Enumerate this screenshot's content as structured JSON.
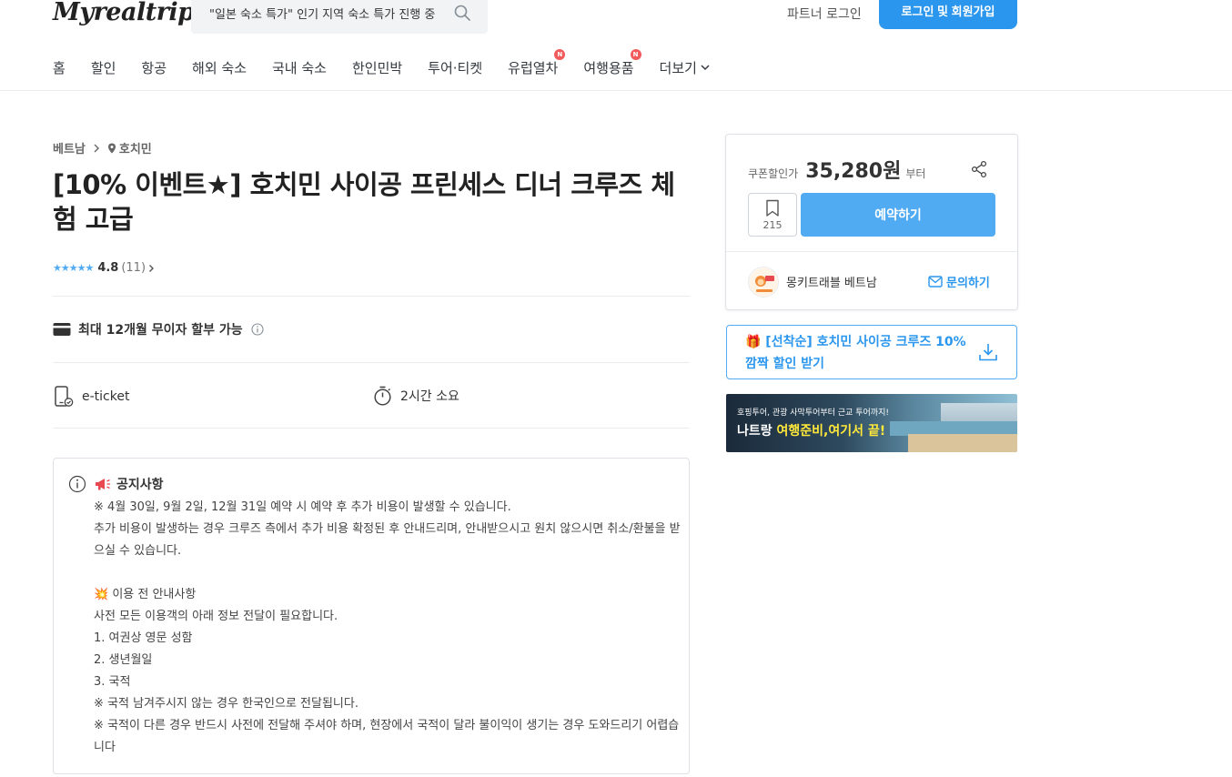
{
  "header": {
    "logo": "Myrealtrip",
    "search_text": "\"일본 숙소 특가\" 인기 지역 숙소 특가 진행 중",
    "partner_login": "파트너 로그인",
    "login_signup": "로그인 및 회원가입"
  },
  "nav": {
    "items": [
      {
        "label": "홈",
        "badge": ""
      },
      {
        "label": "할인",
        "badge": ""
      },
      {
        "label": "항공",
        "badge": ""
      },
      {
        "label": "해외 숙소",
        "badge": ""
      },
      {
        "label": "국내 숙소",
        "badge": ""
      },
      {
        "label": "한인민박",
        "badge": ""
      },
      {
        "label": "투어·티켓",
        "badge": ""
      },
      {
        "label": "유럽열차",
        "badge": "N"
      },
      {
        "label": "여행용품",
        "badge": "N"
      }
    ],
    "more": "더보기"
  },
  "breadcrumb": {
    "country": "베트남",
    "city": "호치민"
  },
  "product": {
    "title": "[10% 이벤트★] 호치민 사이공 프린세스 디너 크루즈 체험 고급",
    "stars": "★★★★★",
    "rating_score": "4.8",
    "rating_count": "(11)",
    "installment": "최대 12개월 무이자 할부 가능",
    "ticket_type": "e-ticket",
    "duration": "2시간 소요"
  },
  "notice": {
    "title": "공지사항",
    "lines": [
      "※ 4월 30일, 9월 2일, 12월 31일 예약 시 예약 후 추가 비용이 발생할 수 있습니다.",
      "추가 비용이 발생하는 경우 크루즈 측에서 추가 비용 확정된 후 안내드리며, 안내받으시고 원치 않으시면 취소/환불을 받으실 수 있습니다.",
      "",
      "💥 이용 전 안내사항",
      "사전 모든 이용객의 아래 정보 전달이 필요합니다.",
      "1. 여권상 영문 성함",
      "2. 생년월일",
      "3. 국적",
      "※ 국적 남겨주시지 않는 경우 한국인으로 전달됩니다.",
      "※ 국적이 다른 경우 반드시 사전에 전달해 주셔야 하며, 현장에서 국적이 달라 불이익이 생기는 경우 도와드리기 어렵습니다"
    ]
  },
  "booking": {
    "price_label": "쿠폰할인가",
    "price": "35,280원",
    "price_suffix": "부터",
    "wishlist_count": "215",
    "reserve": "예약하기",
    "seller": "몽키트래블 베트남",
    "contact": "문의하기"
  },
  "coupon": {
    "text": "🎁 [선착순] 호치민 사이공 크루즈 10% 깜짝 할인 받기"
  },
  "banner": {
    "sub": "호핑투어, 관광 사막투어부터 근교 투어까지!",
    "main_a": "나트랑 ",
    "main_b": "여행준비,여기서 끝!"
  },
  "colors": {
    "brand_blue": "#2b96ed",
    "button_blue": "#51abf3",
    "badge_red": "#f25b5b"
  }
}
